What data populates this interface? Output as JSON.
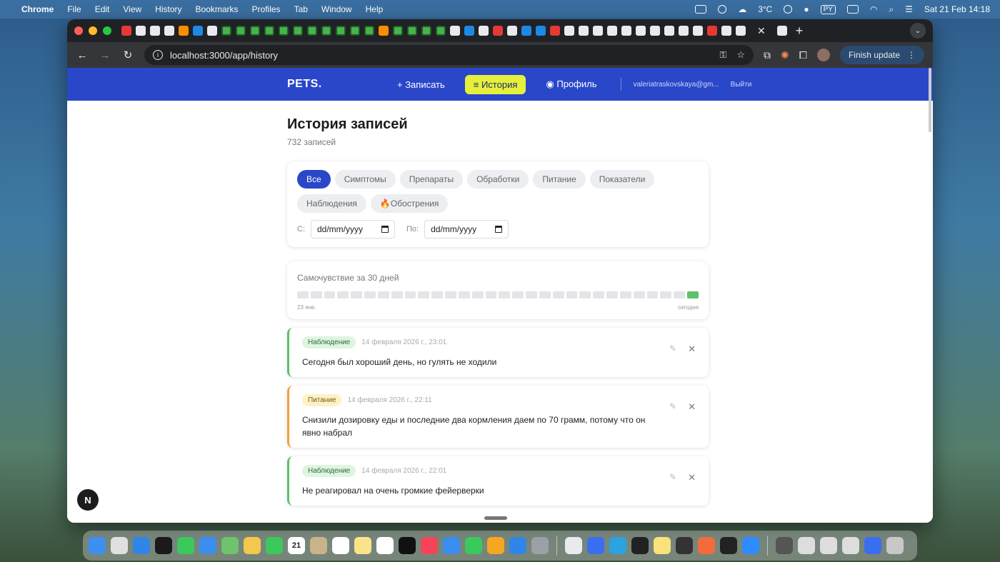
{
  "menubar": {
    "app": "Chrome",
    "items": [
      "File",
      "Edit",
      "View",
      "History",
      "Bookmarks",
      "Profiles",
      "Tab",
      "Window",
      "Help"
    ],
    "weather": "3°C",
    "lang": "PY",
    "datetime": "Sat 21 Feb  14:18"
  },
  "browser": {
    "url": "localhost:3000/app/history",
    "finish_update": "Finish update"
  },
  "app": {
    "logo": "PETS.",
    "nav": {
      "record": "+ Записать",
      "history": "≡ История",
      "profile": "◉ Профиль"
    },
    "user_email": "valeriatraskovskaya@gm...",
    "logout": "Выйти"
  },
  "history": {
    "title": "История записей",
    "count": "732 записей",
    "filters": [
      "Все",
      "Симптомы",
      "Препараты",
      "Обработки",
      "Питание",
      "Показатели",
      "Наблюдения",
      "🔥Обострения"
    ],
    "date_from_label": "С:",
    "date_to_label": "По:",
    "date_placeholder": "dd/mm/yyyy"
  },
  "mood": {
    "title": "Самочувствие за 30 дней",
    "start_label": "23 янв.",
    "end_label": "сегодня",
    "days": 30,
    "good_days": 1
  },
  "entries": [
    {
      "type": "Наблюдение",
      "date": "14 февраля 2026 г., 23:01",
      "text": "Сегодня был хороший день, но гулять не ходили",
      "color": "#5cc16a"
    },
    {
      "type": "Питание",
      "date": "14 февраля 2026 г., 22:11",
      "text": "Снизили дозировку еды и последние два кормления даем по 70 грамм, потому что он явно набрал",
      "color": "#f0a33c"
    },
    {
      "type": "Наблюдение",
      "date": "14 февраля 2026 г., 22:01",
      "text": "Не реагировал на очень громкие фейерверки",
      "color": "#5cc16a"
    }
  ],
  "fab": "N",
  "dock_date": "21"
}
